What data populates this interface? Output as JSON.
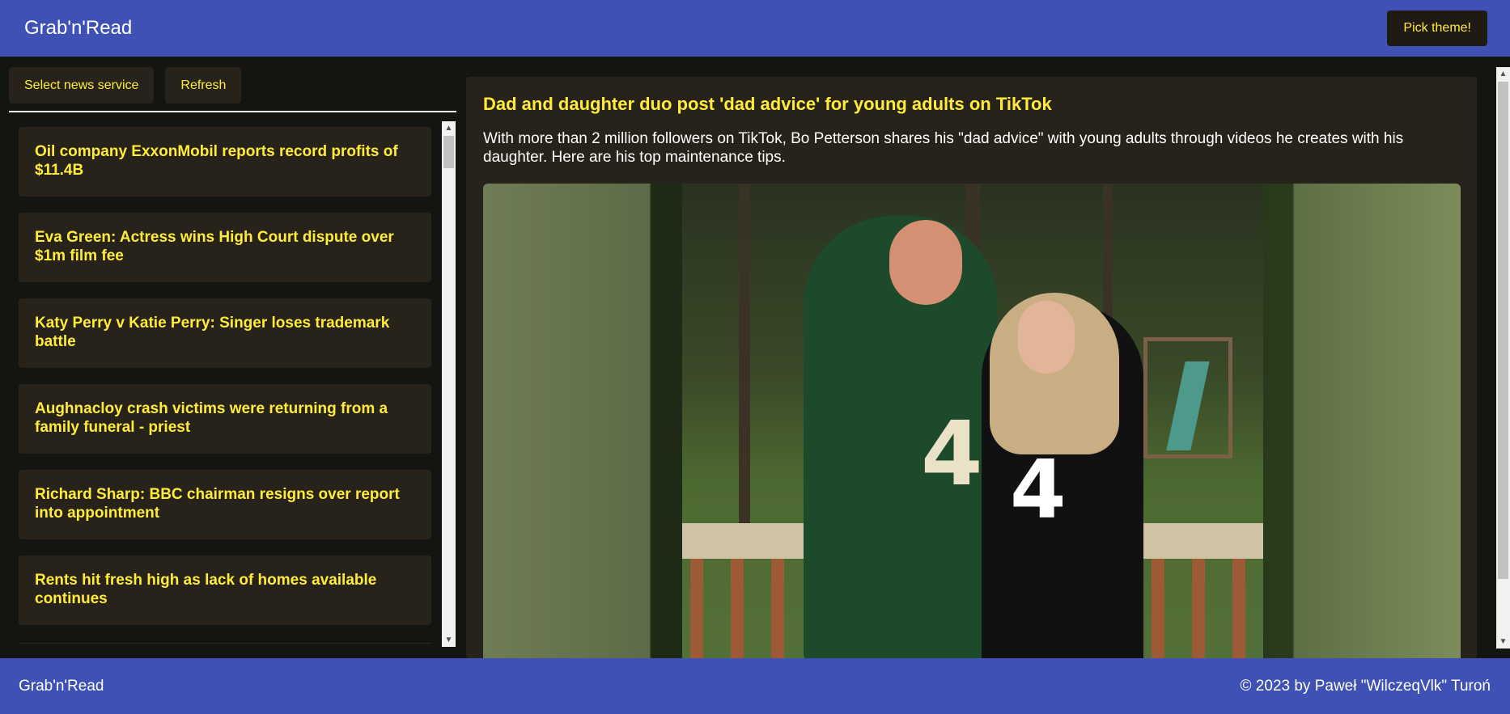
{
  "header": {
    "brand": "Grab'n'Read",
    "theme_button": "Pick theme!"
  },
  "controls": {
    "select_service": "Select news service",
    "refresh": "Refresh"
  },
  "news": [
    "Oil company ExxonMobil reports record profits of $11.4B",
    "Eva Green: Actress wins High Court dispute over $1m film fee",
    "Katy Perry v Katie Perry: Singer loses trademark battle",
    "Aughnacloy crash victims were returning from a family funeral - priest",
    "Richard Sharp: BBC chairman resigns over report into appointment",
    "Rents hit fresh high as lack of homes available continues"
  ],
  "article": {
    "title": "Dad and daughter duo post 'dad advice' for young adults on TikTok",
    "description": "With more than 2 million followers on TikTok, Bo Petterson shares his \"dad advice\" with young adults through videos he creates with his daughter. Here are his top maintenance tips.",
    "jersey_man": "4",
    "jersey_woman": "4"
  },
  "footer": {
    "brand": "Grab'n'Read",
    "copyright": "© 2023 by Paweł \"WilczeqVlk\" Turoń"
  },
  "colors": {
    "accent": "#3f51b5",
    "highlight": "#ffeb3b",
    "panel": "#27231a",
    "background": "#141410"
  }
}
